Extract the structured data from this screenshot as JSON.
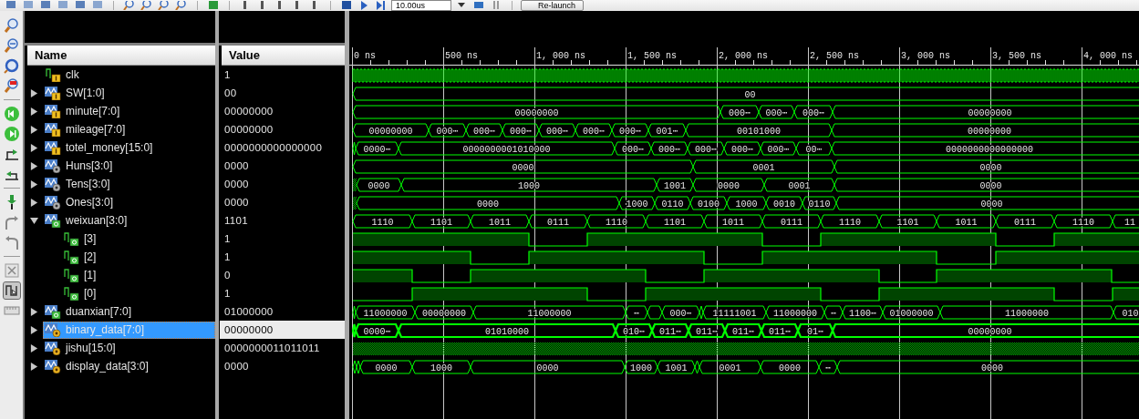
{
  "toolbar": {
    "time_field": "10.00us",
    "relaunch_button": "Re-launch"
  },
  "side_toolbar": {
    "toggle_on": true
  },
  "name_panel": {
    "header": "Name"
  },
  "value_panel": {
    "header": "Value"
  },
  "timeline": {
    "ticks": [
      "0 ns",
      "500 ns",
      "1, 000 ns",
      "1, 500 ns",
      "2, 000 ns",
      "2, 500 ns",
      "3, 000 ns",
      "3, 500 ns",
      "4, 000 ns"
    ]
  },
  "signals": [
    {
      "name": "clk",
      "value": "1",
      "kind": "in_bit",
      "selected": false
    },
    {
      "name": "SW[1:0]",
      "value": "00",
      "kind": "in_bus",
      "expanded": false,
      "selected": false,
      "wave_labels": [
        "00"
      ]
    },
    {
      "name": "minute[7:0]",
      "value": "00000000",
      "kind": "in_bus",
      "expanded": false,
      "selected": false,
      "wave_labels": [
        "00000000",
        "000⋯",
        "000⋯",
        "000⋯",
        "00000000"
      ]
    },
    {
      "name": "mileage[7:0]",
      "value": "00000000",
      "kind": "in_bus",
      "expanded": false,
      "selected": false,
      "wave_labels": [
        "00000000",
        "000⋯",
        "000⋯",
        "000⋯",
        "000⋯",
        "000⋯",
        "000⋯",
        "001⋯",
        "00101000",
        "00000000"
      ]
    },
    {
      "name": "totel_money[15:0]",
      "value": "0000000000000000",
      "kind": "in_bus",
      "expanded": false,
      "selected": false,
      "wave_labels": [
        "0000⋯",
        "0000000001010000",
        "000⋯",
        "000⋯",
        "000⋯",
        "000⋯",
        "000⋯",
        "00⋯",
        "0000000000000000"
      ]
    },
    {
      "name": "Huns[3:0]",
      "value": "0000",
      "kind": "int_bus",
      "expanded": false,
      "selected": false,
      "wave_labels": [
        "0000",
        "0001",
        "0000"
      ]
    },
    {
      "name": "Tens[3:0]",
      "value": "0000",
      "kind": "int_bus",
      "expanded": false,
      "selected": false,
      "wave_labels": [
        "0000",
        "1000",
        "1001",
        "0000",
        "0001",
        "0000"
      ]
    },
    {
      "name": "Ones[3:0]",
      "value": "0000",
      "kind": "int_bus",
      "expanded": false,
      "selected": false,
      "wave_labels": [
        "0000",
        "1000",
        "0110",
        "0100",
        "1000",
        "0010",
        "0110",
        "0000"
      ]
    },
    {
      "name": "weixuan[3:0]",
      "value": "1101",
      "kind": "out_bus",
      "expanded": true,
      "selected": false,
      "wave_labels": [
        "1110",
        "1101",
        "1011",
        "0111",
        "1110",
        "1101",
        "1011",
        "0111",
        "1110",
        "1101",
        "1011",
        "0111",
        "1110",
        "11"
      ],
      "children": [
        {
          "name": "[3]",
          "value": "1",
          "kind": "out_bit",
          "selected": false
        },
        {
          "name": "[2]",
          "value": "1",
          "kind": "out_bit",
          "selected": false
        },
        {
          "name": "[1]",
          "value": "0",
          "kind": "out_bit",
          "selected": false
        },
        {
          "name": "[0]",
          "value": "1",
          "kind": "out_bit",
          "selected": false
        }
      ]
    },
    {
      "name": "duanxian[7:0]",
      "value": "01000000",
      "kind": "out_bus",
      "expanded": false,
      "selected": false,
      "wave_labels": [
        "11000000",
        "00000000",
        "11000000",
        "⋯",
        "000⋯",
        "11111001",
        "11000000",
        "⋯",
        "1100⋯",
        "01000000",
        "11000000",
        "010"
      ]
    },
    {
      "name": "binary_data[7:0]",
      "value": "00000000",
      "kind": "var_bus",
      "expanded": false,
      "selected": true,
      "wave_labels": [
        "0000⋯",
        "01010000",
        "010⋯",
        "011⋯",
        "011⋯",
        "011⋯",
        "011⋯",
        "01⋯",
        "00000000"
      ]
    },
    {
      "name": "jishu[15:0]",
      "value": "0000000011011011",
      "kind": "var_bus",
      "expanded": false,
      "selected": false
    },
    {
      "name": "display_data[3:0]",
      "value": "0000",
      "kind": "var_bus",
      "expanded": false,
      "selected": false,
      "wave_labels": [
        "0000",
        "1000",
        "0000",
        "1000",
        "1001",
        "0001",
        "0000",
        "⋯",
        "0000"
      ]
    }
  ]
}
